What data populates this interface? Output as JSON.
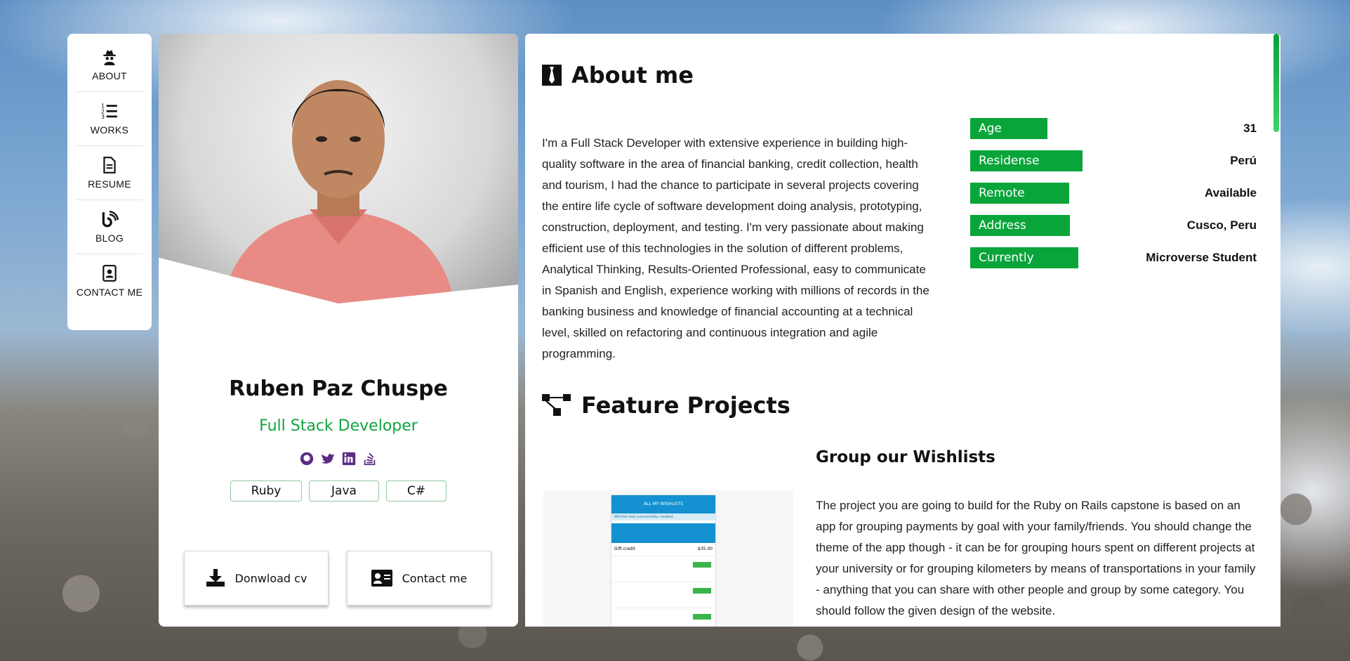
{
  "nav": {
    "items": [
      {
        "label": "ABOUT",
        "icon": "spy-icon"
      },
      {
        "label": "WORKS",
        "icon": "numbered-list-icon"
      },
      {
        "label": "RESUME",
        "icon": "document-icon"
      },
      {
        "label": "BLOG",
        "icon": "blog-icon"
      },
      {
        "label": "CONTACT ME",
        "icon": "contact-book-icon"
      }
    ]
  },
  "profile": {
    "name": "Ruben Paz Chuspe",
    "role": "Full Stack Developer",
    "socials": [
      "github-icon",
      "twitter-icon",
      "linkedin-icon",
      "stackoverflow-icon"
    ],
    "tags": [
      "Ruby",
      "Java",
      "C#"
    ],
    "download_label": "Donwload cv",
    "contact_label": "Contact me"
  },
  "about": {
    "title": "About me",
    "text": "I'm a Full Stack Developer with extensive experience in building high-quality software in the area of financial banking, credit collection, health and tourism, I had the chance to participate in several projects covering the entire life cycle of software development doing analysis, prototyping, construction, deployment, and testing. I'm very passionate about making efficient use of this technologies in the solution of different problems, Analytical Thinking, Results-Oriented Professional, easy to communicate in Spanish and English, experience working with millions of records in the banking business and knowledge of financial accounting at a technical level, skilled on refactoring and continuous integration and agile programming.",
    "info": [
      {
        "key": "Age",
        "value": "31"
      },
      {
        "key": "Residense",
        "value": "Perú"
      },
      {
        "key": "Remote",
        "value": "Available"
      },
      {
        "key": "Address",
        "value": "Cusco, Peru"
      },
      {
        "key": "Currently",
        "value": "Microverse Student"
      }
    ]
  },
  "projects": {
    "title": "Feature Projects",
    "items": [
      {
        "title": "Group our Wishlists",
        "description": "The project you are going to build for the Ruby on Rails capstone is based on an app for grouping payments by goal with your family/friends. You should change the theme of the app though - it can be for grouping hours spent on different projects at your university or for grouping kilometers by means of transportations in your family - anything that you can share with other people and group by some category. You should follow the given design of the website.",
        "screenshot": {
          "header": "ALL MY WISHLISTS",
          "notice": "Wishlist was successfully created.",
          "gift_label": "Gift credit",
          "gift_amount": "$35.00"
        }
      }
    ]
  },
  "colors": {
    "accent": "#0aa53a",
    "brand_blue": "#1491d0"
  }
}
